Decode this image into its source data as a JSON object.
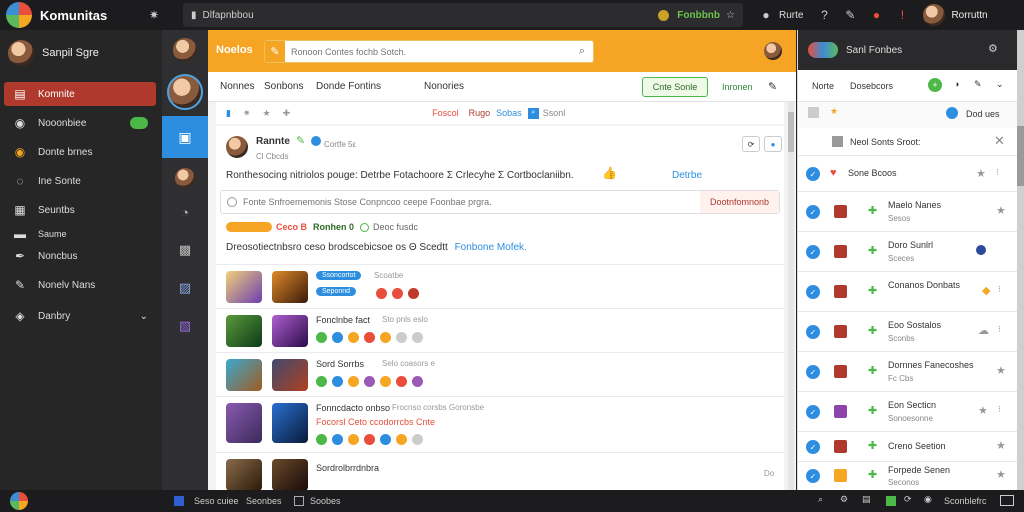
{
  "app": {
    "title": "Komunitas"
  },
  "topbar": {
    "path": "Dlfapnbbou",
    "status": "Fonbbnb",
    "profile_label": "Rurte",
    "user_name": "Rorruttn"
  },
  "sidebar": {
    "user_name": "Sanpil Sgre",
    "items": [
      {
        "label": "Komnite"
      },
      {
        "label": "Nooonbiee"
      },
      {
        "label": "Donte brnes"
      },
      {
        "label": "Ine Sonte"
      },
      {
        "label": "Seuntbs"
      },
      {
        "label": "Saume"
      },
      {
        "label": "Noncbus"
      },
      {
        "label": "Nonelv Nans"
      },
      {
        "label": "Danbry"
      }
    ]
  },
  "header": {
    "title": "Noelos",
    "search_placeholder": "Ronoon Contes fochb Sotch."
  },
  "subnav": {
    "tabs": [
      {
        "label": "Nonnes"
      },
      {
        "label": "Sonbons"
      },
      {
        "label": "Donde Fontins"
      },
      {
        "label": "Nonories"
      }
    ],
    "action_button": "Cnte Sonle",
    "action_link": "Inronen"
  },
  "filters": {
    "tab_trending": "Foscol",
    "tab_popular": "Rugo",
    "tab_latest": "Sobas",
    "tab_search": "Ssonl"
  },
  "post": {
    "author": "Rannte",
    "meta_a": "Cortfe 5ε",
    "meta_b": "Cl Cbcds",
    "body": "Ronthesocing nitriolos pouge: Detrbe Fotachoore Σ Crlecyhe Σ Cortboclaniibn.",
    "body_link": "Detrbe",
    "reply_placeholder": "Fonte Snfroememonis Stose Conpncoo ceepe Foonbae prgra.",
    "reply_button": "Dootnfomnonb",
    "tag_a": "Ceco B",
    "tag_b": "Ronhen 0",
    "tag_c": "Deoc fusdc",
    "caption": "Dreosotiectnbsro ceso brodscebicsoe os Θ Scedtt",
    "caption_link": "Fonbone Mofek."
  },
  "feed": [
    {
      "title_a": "Ssoncortot",
      "title_b": "Seponnd",
      "meta": "Scoatbe"
    },
    {
      "title_a": "Fonclnbe fact",
      "meta": "Sto pnls eslo"
    },
    {
      "title_a": "Sord Sorrbs",
      "meta": "Selo coasors e"
    },
    {
      "title_a": "Fonncdacto onbso",
      "meta": "Frocnso corsbs Goronsbe",
      "title_b": "Focorsl Ceto ccodorrcbs Cnte"
    },
    {
      "title_a": "Sordrolbrrdnbra",
      "meta": "Do"
    }
  ],
  "right_panel": {
    "title": "Sanl Fonbes",
    "tab_a": "Norte",
    "tab_b": "Dosebcors",
    "label_top": "Dod ues",
    "search_text": "Neol Sonts Sroot:",
    "items": [
      {
        "name": "Sone Bcoos",
        "sub": ""
      },
      {
        "name": "Maelo Nanes",
        "sub": "Sesos"
      },
      {
        "name": "Doro Sunlrl",
        "sub": "Sceces"
      },
      {
        "name": "Conanos Donbats",
        "sub": ""
      },
      {
        "name": "Eoo Sostalos",
        "sub": "Sconbs"
      },
      {
        "name": "Dornnes Fanecoshes",
        "sub": "Fc Cbs"
      },
      {
        "name": "Eon Secticn",
        "sub": "Sonoesonne"
      },
      {
        "name": "Creno Seetion",
        "sub": ""
      },
      {
        "name": "Forpede Senen",
        "sub": "Seconos"
      }
    ]
  },
  "statusbar": {
    "left_a": "Seso cuiee",
    "left_b": "Seonbes",
    "left_c": "Soobes",
    "right": "Sconblefrc"
  },
  "colors": {
    "accent_orange": "#f6a424",
    "sidebar_active": "#b0392d",
    "link_blue": "#2d8ee0",
    "success_green": "#4cb848"
  }
}
